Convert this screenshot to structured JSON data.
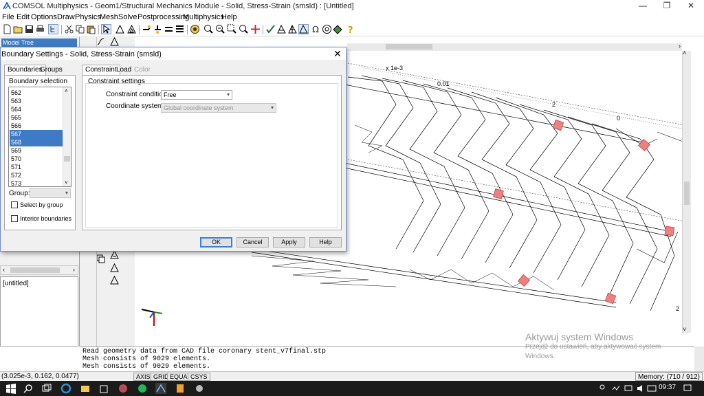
{
  "window": {
    "title": "COMSOL Multiphysics - Geom1/Structural Mechanics Module - Solid, Stress-Strain (smsld) : [Untitled]",
    "minimize": "—",
    "maximize": "❐",
    "close": "✕"
  },
  "menu": [
    "File",
    "Edit",
    "Options",
    "Draw",
    "Physics",
    "Mesh",
    "Solve",
    "Postprocessing",
    "Multiphysics",
    "Help"
  ],
  "model_tree": {
    "field": "Model Tree",
    "root": "[untitled]"
  },
  "dialog": {
    "title": "Boundary Settings - Solid, Stress-Strain (smsld)",
    "close_label": "✕",
    "left_tabs": [
      "Boundaries",
      "Groups"
    ],
    "boundary_selection_label": "Boundary selection",
    "boundary_items": [
      {
        "label": "562",
        "selected": false
      },
      {
        "label": "563",
        "selected": false
      },
      {
        "label": "564",
        "selected": false
      },
      {
        "label": "565",
        "selected": false
      },
      {
        "label": "566",
        "selected": false
      },
      {
        "label": "567",
        "selected": true
      },
      {
        "label": "568",
        "selected": true
      },
      {
        "label": "569",
        "selected": false
      },
      {
        "label": "570",
        "selected": false
      },
      {
        "label": "571",
        "selected": false
      },
      {
        "label": "572",
        "selected": false
      },
      {
        "label": "573",
        "selected": false
      }
    ],
    "group_label": "Group:",
    "group_value": "",
    "select_by_group_label": "Select by group",
    "interior_boundaries_label": "Interior boundaries",
    "right_tabs": [
      {
        "label": "Constraint",
        "state": "active"
      },
      {
        "label": "Load",
        "state": "normal"
      },
      {
        "label": "Color",
        "state": "disabled"
      }
    ],
    "constraint_settings_label": "Constraint settings",
    "constraint_condition_label": "Constraint condition:",
    "constraint_condition_value": "Free",
    "coordinate_system_label": "Coordinate system:",
    "coordinate_system_value": "Global coordinate system",
    "buttons": {
      "ok": "OK",
      "cancel": "Cancel",
      "apply": "Apply",
      "help": "Help"
    }
  },
  "canvas": {
    "axis_scale": "x 1e-3",
    "axis_tick_1": "0.01",
    "axis_tick_2": "2",
    "axis_tick_3": "0",
    "axis_tick_4": "2"
  },
  "log": [
    "Read geometry data from CAD file coronary stent_v7final.stp",
    "Mesh consists of 9029 elements.",
    "Mesh consists of 9029 elements."
  ],
  "status": {
    "coordinates": "(3.025e-3, 0.162, 0.0477)",
    "toggles": [
      "AXIS",
      "GRID",
      "EQUAL",
      "CSYS"
    ],
    "memory": "Memory: (710 / 912)"
  },
  "watermark": {
    "title": "Aktywuj system Windows",
    "subtitle": "Przejdź do ustawień, aby aktywować system Windows."
  },
  "taskbar": {
    "time": "09:37"
  },
  "colors": {
    "selection": "#3d7bc6",
    "mesh_marker": "#f08080",
    "taskbar": "#1b1b1b"
  }
}
